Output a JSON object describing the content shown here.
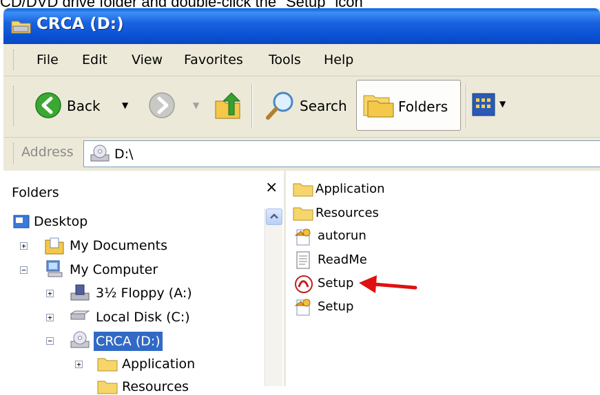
{
  "caption": "CD/DVD drive folder and double-click the \"Setup\" icon",
  "window": {
    "title": "CRCA (D:)"
  },
  "menu": [
    "File",
    "Edit",
    "View",
    "Favorites",
    "Tools",
    "Help"
  ],
  "toolbar": {
    "back_label": "Back",
    "search_label": "Search",
    "folders_label": "Folders"
  },
  "address": {
    "label": "Address",
    "value": "D:\\"
  },
  "folders_pane": {
    "title": "Folders",
    "close_glyph": "×",
    "tree": [
      {
        "label": "Desktop"
      },
      {
        "label": "My Documents"
      },
      {
        "label": "My Computer"
      },
      {
        "label": "3½ Floppy (A:)"
      },
      {
        "label": "Local Disk (C:)"
      },
      {
        "label": "CRCA (D:)",
        "selected": true
      },
      {
        "label": "Application"
      },
      {
        "label": "Resources"
      }
    ]
  },
  "files": [
    {
      "name": "Application",
      "icon": "folder-icon"
    },
    {
      "name": "Resources",
      "icon": "folder-icon"
    },
    {
      "name": "autorun",
      "icon": "setup-info-icon"
    },
    {
      "name": "ReadMe",
      "icon": "text-file-icon"
    },
    {
      "name": "Setup",
      "icon": "acrobat-setup-icon"
    },
    {
      "name": "Setup",
      "icon": "setup-info-icon"
    }
  ],
  "annotation": {
    "arrow_color": "#e01010",
    "points_to": "Setup"
  },
  "colors": {
    "titlebar": "#0a5fdc",
    "selection": "#316ac5",
    "chrome": "#ece9d8"
  }
}
